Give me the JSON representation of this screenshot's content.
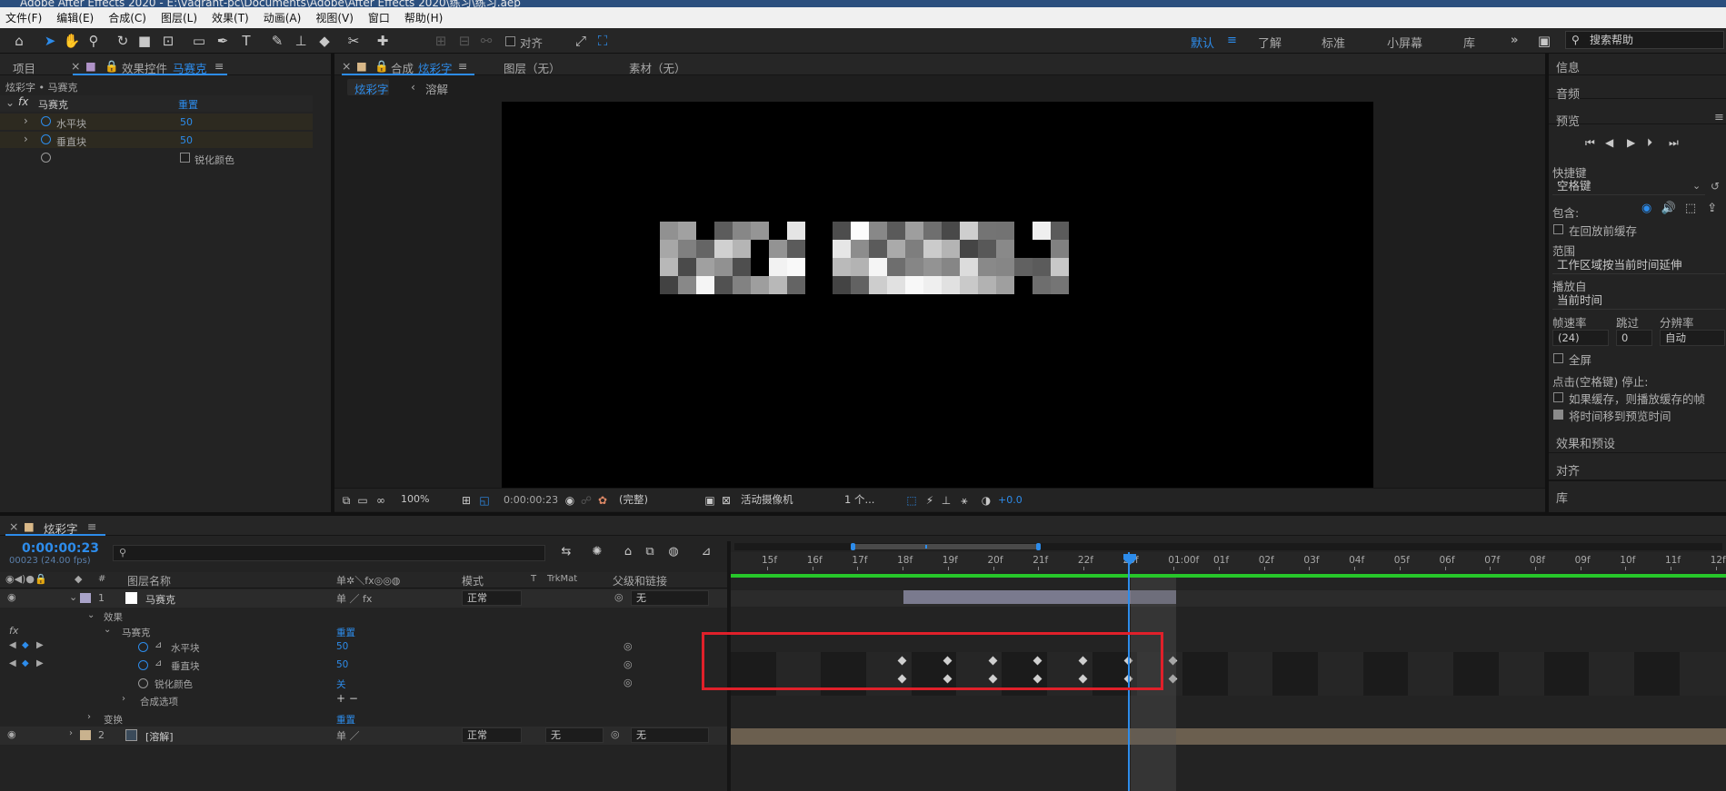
{
  "window": {
    "title": "Adobe After Effects 2020 - E:\\vagrant-pc\\Documents\\Adobe\\After Effects 2020\\练习\\练习.aep"
  },
  "menu": [
    "文件(F)",
    "编辑(E)",
    "合成(C)",
    "图层(L)",
    "效果(T)",
    "动画(A)",
    "视图(V)",
    "窗口",
    "帮助(H)"
  ],
  "toolbar": {
    "align_label": "对齐",
    "workspaces": [
      "默认",
      "了解",
      "标准",
      "小屏幕",
      "库"
    ],
    "active_workspace": "默认",
    "more": "»",
    "search_placeholder": "搜索帮助"
  },
  "project_tabs": {
    "project": "项目",
    "effect_controls_prefix": "效果控件",
    "effect_controls_layer": "马赛克"
  },
  "effect_controls": {
    "breadcrumb": "炫彩字 • 马赛克",
    "effect_name": "马赛克",
    "reset_label": "重置",
    "props": [
      {
        "name": "水平块",
        "value": "50"
      },
      {
        "name": "垂直块",
        "value": "50"
      },
      {
        "name": "锐化颜色",
        "value": ""
      }
    ]
  },
  "comp_panel": {
    "tab_prefix": "合成",
    "tab_name": "炫彩字",
    "layer_tab": "图层（无）",
    "footage_tab": "素材（无）",
    "breadcrumbs": [
      "炫彩字",
      "溶解"
    ]
  },
  "viewer_bar": {
    "zoom": "100%",
    "timecode": "0:00:00:23",
    "resolution": "(完整)",
    "camera": "活动摄像机",
    "views": "1 个...",
    "exposure": "+0.0"
  },
  "right_panel": {
    "info": "信息",
    "audio": "音频",
    "preview": "预览",
    "shortcut_label": "快捷键",
    "shortcut_value": "空格键",
    "include_label": "包含:",
    "cache_before_play": "在回放前缓存",
    "range_label": "范围",
    "range_value": "工作区域按当前时间延伸",
    "play_from_label": "播放自",
    "play_from_value": "当前时间",
    "framerate_label": "帧速率",
    "skip_label": "跳过",
    "resolution_label": "分辨率",
    "framerate_value": "(24)",
    "skip_value": "0",
    "resolution_value": "自动",
    "fullscreen": "全屏",
    "stop_label": "点击(空格键) 停止:",
    "if_cached": "如果缓存，则播放缓存的帧",
    "move_time": "将时间移到预览时间",
    "effects_presets": "效果和预设",
    "align": "对齐",
    "library": "库"
  },
  "timeline": {
    "comp_name": "炫彩字",
    "timecode": "0:00:00:23",
    "fps_info": "00023 (24.00 fps)",
    "columns": {
      "layer_name": "图层名称",
      "mode": "模式",
      "t": "T",
      "trkmat": "TrkMat",
      "parent": "父级和链接"
    },
    "layers": [
      {
        "num": "1",
        "name": "马赛克",
        "mode": "正常",
        "parent": "无"
      },
      {
        "num": "2",
        "name": "[溶解]",
        "mode": "正常",
        "trkmat": "无",
        "parent": "无"
      }
    ],
    "sub": {
      "effects": "效果",
      "effect_name": "马赛克",
      "reset": "重置",
      "h_blocks": "水平块",
      "h_value": "50",
      "v_blocks": "垂直块",
      "v_value": "50",
      "sharpen": "锐化颜色",
      "sharpen_value": "关",
      "comp_options": "合成选项",
      "comp_options_ctrl": "+ −",
      "transform": "变换",
      "transform_reset": "重置"
    },
    "ruler": [
      "15f",
      "16f",
      "17f",
      "18f",
      "19f",
      "20f",
      "21f",
      "22f",
      "23f",
      "01:00f",
      "01f",
      "02f",
      "03f",
      "04f",
      "05f",
      "06f",
      "07f",
      "08f",
      "09f",
      "10f",
      "11f",
      "12f"
    ],
    "current_frame": 23,
    "keyframes_frames": [
      18,
      19,
      20,
      21,
      22,
      23,
      24
    ]
  },
  "colors": {
    "accent": "#2d8ceb",
    "highlight_box": "#e0202a",
    "green_bar": "#27c62a"
  }
}
